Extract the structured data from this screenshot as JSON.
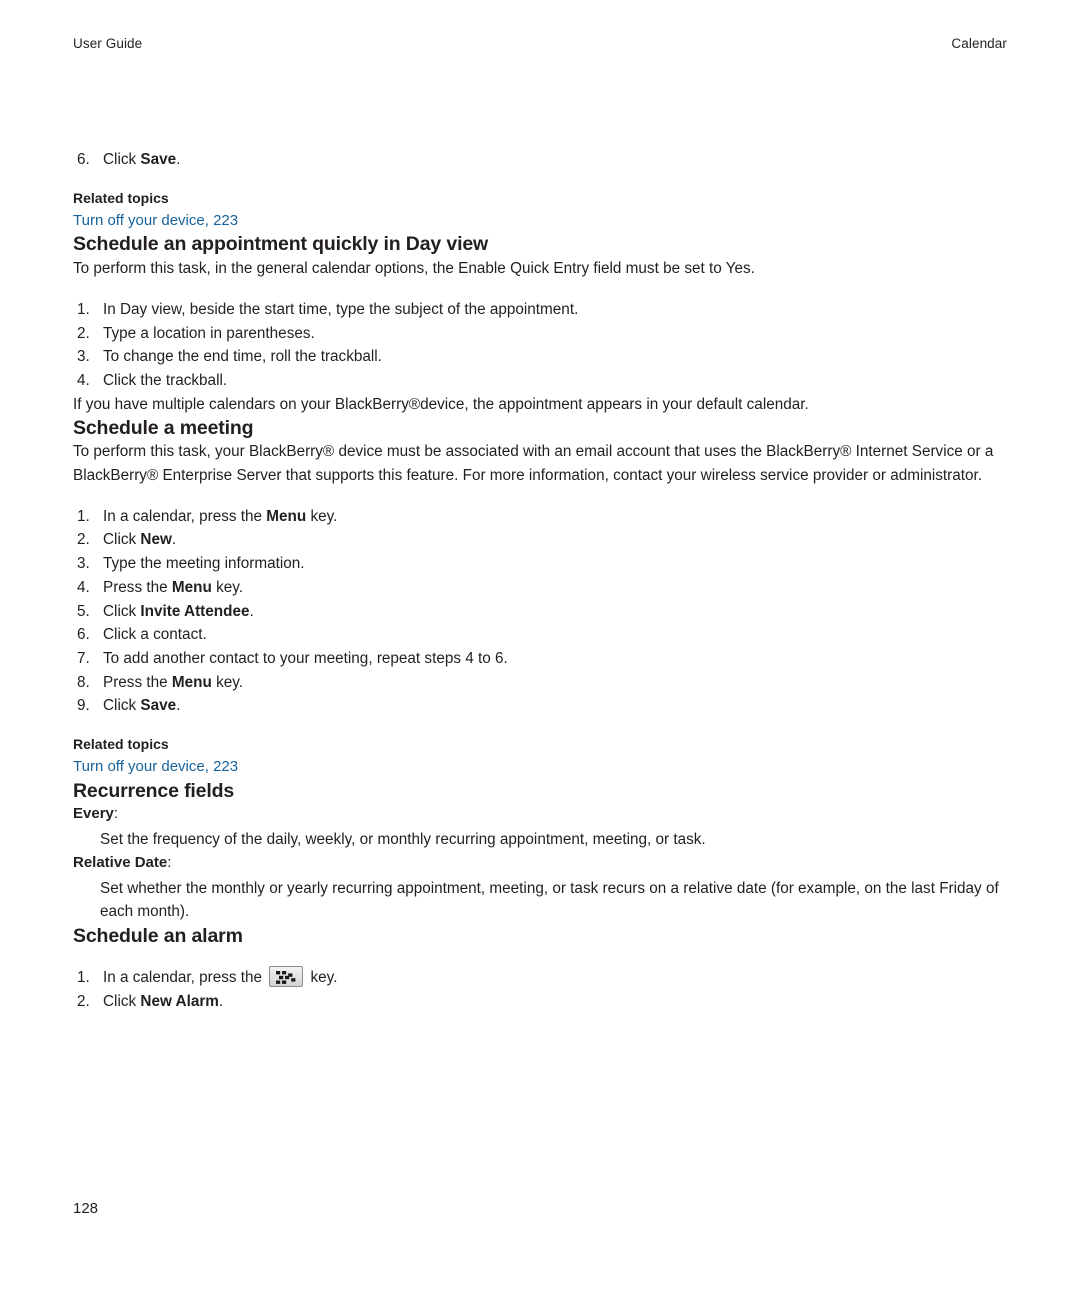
{
  "header": {
    "left": "User Guide",
    "right": "Calendar"
  },
  "link_color": "#17639b",
  "continued_step": {
    "number": "6.",
    "text_before": "Click ",
    "bold": "Save",
    "text_after": "."
  },
  "related_topics_1": {
    "title": "Related topics",
    "link": "Turn off your device, 223"
  },
  "section_day_view": {
    "heading": "Schedule an appointment quickly in Day view",
    "intro": "To perform this task, in the general calendar options, the Enable Quick Entry field must be set to Yes.",
    "steps": [
      {
        "number": "1.",
        "text": "In Day view, beside the start time, type the subject of the appointment."
      },
      {
        "number": "2.",
        "text": "Type a location in parentheses."
      },
      {
        "number": "3.",
        "text": "To change the end time, roll the trackball."
      },
      {
        "number": "4.",
        "text": "Click the trackball."
      }
    ],
    "outro": "If you have multiple calendars on your BlackBerry®device, the appointment appears in your default calendar."
  },
  "section_meeting": {
    "heading": "Schedule a meeting",
    "intro": "To perform this task, your BlackBerry® device must be associated with an email account that uses the BlackBerry® Internet Service or a BlackBerry® Enterprise Server that supports this feature. For more information, contact your wireless service provider or administrator.",
    "steps": [
      {
        "number": "1.",
        "before": "In a calendar, press the ",
        "bold": "Menu",
        "after": " key."
      },
      {
        "number": "2.",
        "before": "Click ",
        "bold": "New",
        "after": "."
      },
      {
        "number": "3.",
        "before": "Type the meeting information.",
        "bold": "",
        "after": ""
      },
      {
        "number": "4.",
        "before": "Press the ",
        "bold": "Menu",
        "after": " key."
      },
      {
        "number": "5.",
        "before": "Click ",
        "bold": "Invite Attendee",
        "after": "."
      },
      {
        "number": "6.",
        "before": "Click a contact.",
        "bold": "",
        "after": ""
      },
      {
        "number": "7.",
        "before": "To add another contact to your meeting, repeat steps 4 to 6.",
        "bold": "",
        "after": ""
      },
      {
        "number": "8.",
        "before": "Press the ",
        "bold": "Menu",
        "after": " key."
      },
      {
        "number": "9.",
        "before": "Click ",
        "bold": "Save",
        "after": "."
      }
    ]
  },
  "related_topics_2": {
    "title": "Related topics",
    "link": "Turn off your device, 223"
  },
  "section_recurrence": {
    "heading": "Recurrence fields",
    "fields": [
      {
        "term": "Every",
        "colon": ":",
        "definition": "Set the frequency of the daily, weekly, or monthly recurring appointment, meeting, or task."
      },
      {
        "term": "Relative Date",
        "colon": ":",
        "definition": "Set whether the monthly or yearly recurring appointment, meeting, or task recurs on a relative date (for example, on the last Friday of each month)."
      }
    ]
  },
  "section_alarm": {
    "heading": "Schedule an alarm",
    "steps": [
      {
        "number": "1.",
        "before": "In a calendar, press the ",
        "key_icon": "blackberry-menu-key-icon",
        "after": " key."
      },
      {
        "number": "2.",
        "before": "Click ",
        "bold": "New Alarm",
        "after": "."
      }
    ]
  },
  "folio": "128"
}
